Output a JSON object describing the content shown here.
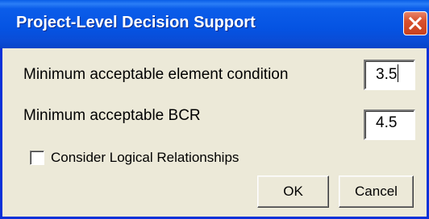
{
  "dialog": {
    "title": "Project-Level Decision Support"
  },
  "fields": {
    "condition_label": "Minimum acceptable element condition",
    "condition_value": "3.5",
    "bcr_label": "Minimum acceptable BCR",
    "bcr_value": "4.5"
  },
  "options": {
    "logical_relationships_label": "Consider Logical Relationships",
    "logical_relationships_checked": false
  },
  "buttons": {
    "ok_label": "OK",
    "cancel_label": "Cancel"
  },
  "icons": {
    "close": "close-icon"
  },
  "colors": {
    "titlebar": "#0553e2",
    "close_button": "#d8502d",
    "window_bg": "#ece9d8"
  }
}
